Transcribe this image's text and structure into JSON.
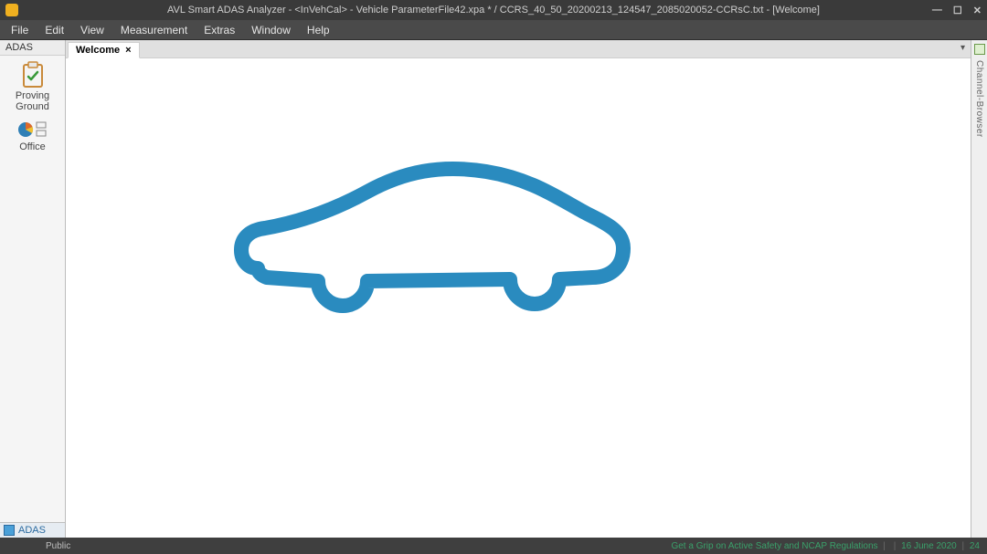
{
  "window": {
    "title": "AVL Smart ADAS Analyzer - <InVehCal> - Vehicle ParameterFile42.xpa * / CCRS_40_50_20200213_124547_2085020052-CCRsC.txt - [Welcome]"
  },
  "menu": {
    "items": [
      "File",
      "Edit",
      "View",
      "Measurement",
      "Extras",
      "Window",
      "Help"
    ]
  },
  "left_panel": {
    "header": "ADAS",
    "tools": [
      {
        "label": "Proving Ground"
      },
      {
        "label": "Office"
      }
    ],
    "bottom_tab": "ADAS"
  },
  "tabs": {
    "items": [
      {
        "label": "Welcome",
        "active": true
      }
    ]
  },
  "right_rail": {
    "label": "Channel-Browser"
  },
  "footer": {
    "left": "Public",
    "right_a": "Get a Grip on Active Safety and NCAP Regulations",
    "right_b": "16 June 2020",
    "right_c": "24"
  },
  "colors": {
    "accent_blue": "#2a8bbf"
  }
}
